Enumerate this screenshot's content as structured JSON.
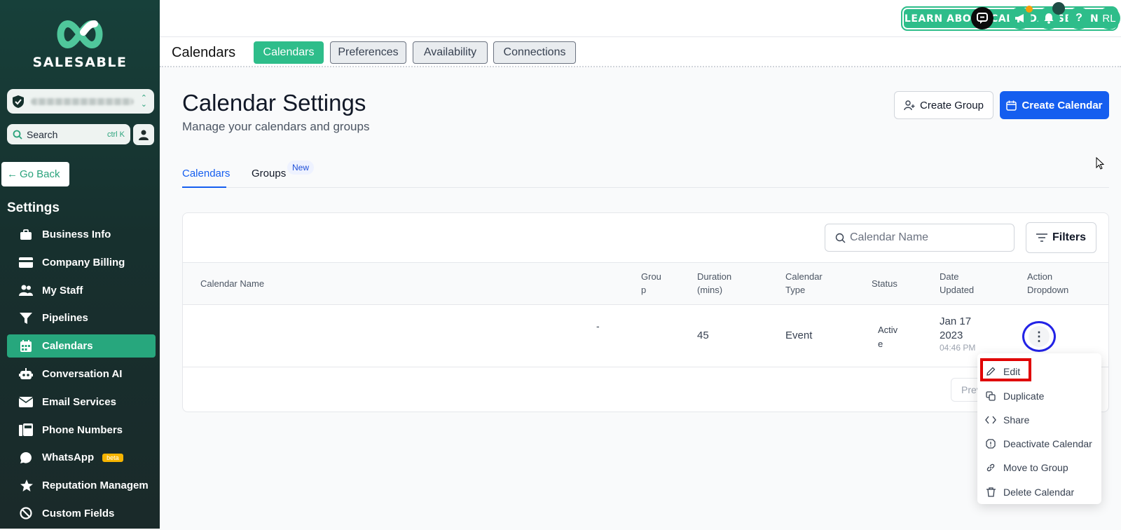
{
  "sidebar": {
    "brand": "SALESABLE",
    "search_label": "Search",
    "search_hint": "ctrl K",
    "go_back": "Go Back",
    "settings_heading": "Settings",
    "items": [
      {
        "label": "Business Info",
        "icon": "briefcase-icon"
      },
      {
        "label": "Company Billing",
        "icon": "credit-card-icon"
      },
      {
        "label": "My Staff",
        "icon": "users-icon"
      },
      {
        "label": "Pipelines",
        "icon": "funnel-icon"
      },
      {
        "label": "Calendars",
        "icon": "calendar-icon",
        "active": true
      },
      {
        "label": "Conversation AI",
        "icon": "robot-icon"
      },
      {
        "label": "Email Services",
        "icon": "email-icon"
      },
      {
        "label": "Phone Numbers",
        "icon": "phone-icon"
      },
      {
        "label": "WhatsApp",
        "icon": "whatsapp-icon",
        "badge": "beta"
      },
      {
        "label": "Reputation Managem",
        "icon": "star-icon"
      },
      {
        "label": "Custom Fields",
        "icon": "custom-fields-icon"
      }
    ]
  },
  "topbar": {
    "learn_button": "LEARN ABOUT CALENDAR SETTINGS",
    "avatar_initials": "RL"
  },
  "subbar": {
    "title": "Calendars",
    "tabs": [
      "Calendars",
      "Preferences",
      "Availability",
      "Connections"
    ]
  },
  "main": {
    "title": "Calendar Settings",
    "subtitle": "Manage your calendars and groups",
    "create_group": "Create Group",
    "create_calendar": "Create Calendar",
    "tabs": [
      {
        "label": "Calendars"
      },
      {
        "label": "Groups",
        "badge": "New"
      }
    ],
    "search_placeholder": "Calendar Name",
    "filters": "Filters",
    "columns": {
      "name": "Calendar Name",
      "group_1": "Grou",
      "group_2": "p",
      "duration_1": "Duration",
      "duration_2": "(mins)",
      "type_1": "Calendar",
      "type_2": "Type",
      "status": "Status",
      "updated_1": "Date",
      "updated_2": "Updated",
      "action_1": "Action",
      "action_2": "Dropdown"
    },
    "row": {
      "group": "-",
      "duration": "45",
      "type": "Event",
      "status_1": "Activ",
      "status_2": "e",
      "date_1": "Jan 17",
      "date_2": "2023",
      "time": "04:46 PM"
    },
    "prev": "Prev"
  },
  "dropdown": [
    {
      "label": "Edit",
      "icon": "pencil-icon"
    },
    {
      "label": "Duplicate",
      "icon": "copy-icon"
    },
    {
      "label": "Share",
      "icon": "code-icon"
    },
    {
      "label": "Deactivate Calendar",
      "icon": "octagon-alert-icon"
    },
    {
      "label": "Move to Group",
      "icon": "link-icon"
    },
    {
      "label": "Delete Calendar",
      "icon": "trash-icon"
    }
  ],
  "colors": {
    "brand_green": "#2ebd8a",
    "primary_blue": "#155eef",
    "sidebar_bg": "#17403a"
  }
}
